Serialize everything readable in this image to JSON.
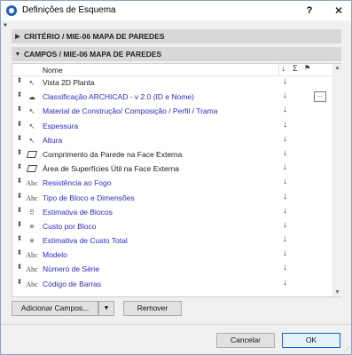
{
  "window": {
    "title": "Definições de Esquema",
    "help_label": "?",
    "close_label": "✕"
  },
  "sections": [
    {
      "label": "CRITÉRIO / MIE-06 MAPA DE PAREDES",
      "expanded": false,
      "toggle": "▶"
    },
    {
      "label": "CAMPOS / MIE-06 MAPA DE PAREDES",
      "expanded": true,
      "toggle": "▼"
    }
  ],
  "list": {
    "header": {
      "name": "Nome",
      "sort": "↓",
      "sum": "Σ",
      "flag": "⚑"
    },
    "rows": [
      {
        "icon": "cursor-icon",
        "glyph": "↖",
        "name": "Vista 2D Planta",
        "color": "black",
        "sort": "↓"
      },
      {
        "icon": "cloud-icon",
        "glyph": "☁",
        "name": "Classificação ARCHICAD - v 2.0 (ID e Nome)",
        "color": "blue",
        "sort": "↓",
        "more": "..."
      },
      {
        "icon": "cursor-icon",
        "glyph": "↖",
        "name": "Material de Construção/ Composição / Perfil / Trama",
        "color": "blue",
        "sort": "↓"
      },
      {
        "icon": "cursor-icon",
        "glyph": "↖",
        "name": "Espessura",
        "color": "blue",
        "sort": "↓"
      },
      {
        "icon": "cursor-icon",
        "glyph": "↖",
        "name": "Altura",
        "color": "blue",
        "sort": "↓"
      },
      {
        "icon": "area-icon",
        "glyph": "",
        "name": "Comprimento da Parede na Face Externa",
        "color": "black",
        "sort": "↓"
      },
      {
        "icon": "area-icon",
        "glyph": "",
        "name": "Área de Superfícies Útil na Face Externa",
        "color": "black",
        "sort": "↓"
      },
      {
        "icon": "abc-icon",
        "glyph": "Abc",
        "name": "Resistência ao Fogo",
        "color": "blue",
        "sort": "↓"
      },
      {
        "icon": "abc-icon",
        "glyph": "Abc",
        "name": "Tipo de Bloco e Dimensões",
        "color": "blue",
        "sort": "↓"
      },
      {
        "icon": "grid-dots-icon",
        "glyph": "⠿",
        "name": "Estimativa de Blocos",
        "color": "blue",
        "sort": "↓"
      },
      {
        "icon": "compass-icon",
        "glyph": "✳",
        "name": "Custo por Bloco",
        "color": "blue",
        "sort": "↓"
      },
      {
        "icon": "compass-icon",
        "glyph": "✳",
        "name": "Estimativa de Custo Total",
        "color": "blue",
        "sort": "↓"
      },
      {
        "icon": "abc-icon",
        "glyph": "Abc",
        "name": "Modelo",
        "color": "blue",
        "sort": "↓"
      },
      {
        "icon": "abc-icon",
        "glyph": "Abc",
        "name": "Número de Série",
        "color": "blue",
        "sort": "↓"
      },
      {
        "icon": "abc-icon",
        "glyph": "Abc",
        "name": "Código de Barras",
        "color": "blue",
        "sort": "↓"
      }
    ]
  },
  "buttons": {
    "add_fields": "Adicionar Campos...",
    "add_dropdown": "▼",
    "remove": "Remover",
    "cancel": "Cancelar",
    "ok": "OK"
  },
  "colors": {
    "blue_text": "#2b2bc4",
    "section_bg": "#d8d8d8",
    "accent": "#0a64c8"
  }
}
